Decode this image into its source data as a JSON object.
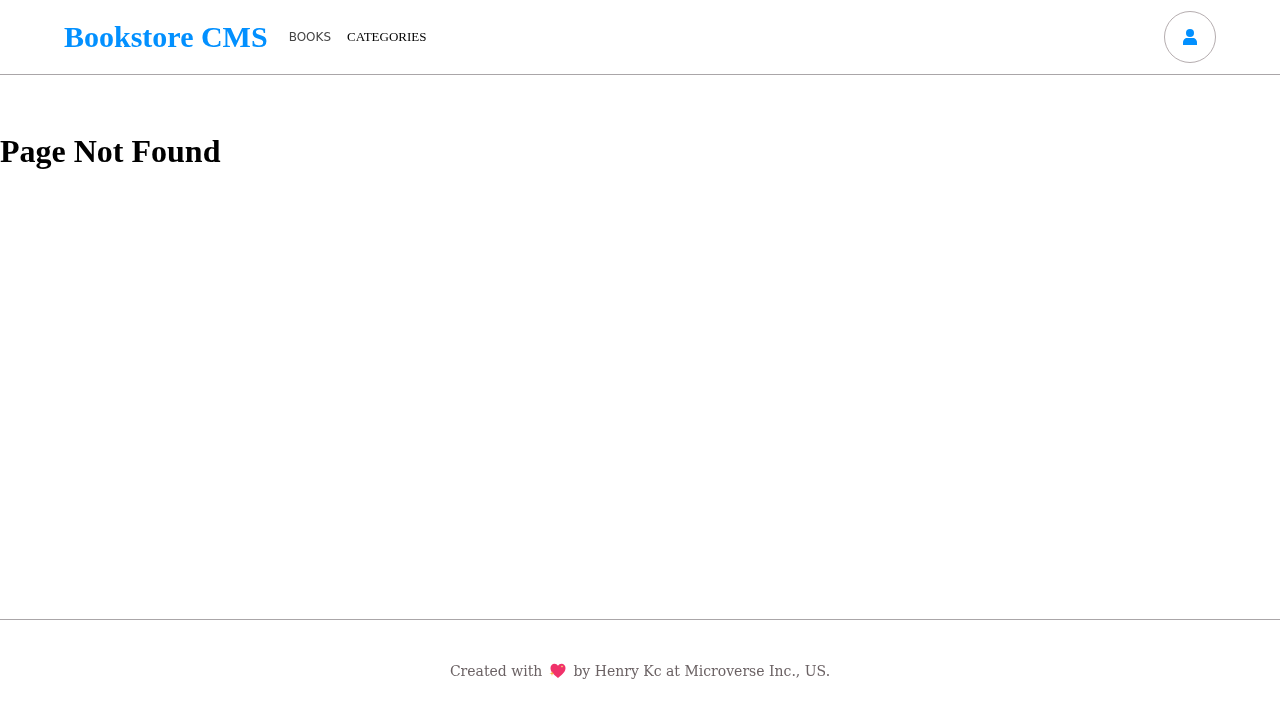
{
  "header": {
    "logo": "Bookstore CMS",
    "nav": [
      {
        "label": "BOOKS",
        "selected": true
      },
      {
        "label": "CATEGORIES",
        "selected": false
      }
    ]
  },
  "main": {
    "heading": "Page Not Found"
  },
  "footer": {
    "before_icon": "Created with",
    "after_icon": "by Henry Kc at Microverse Inc., US."
  }
}
